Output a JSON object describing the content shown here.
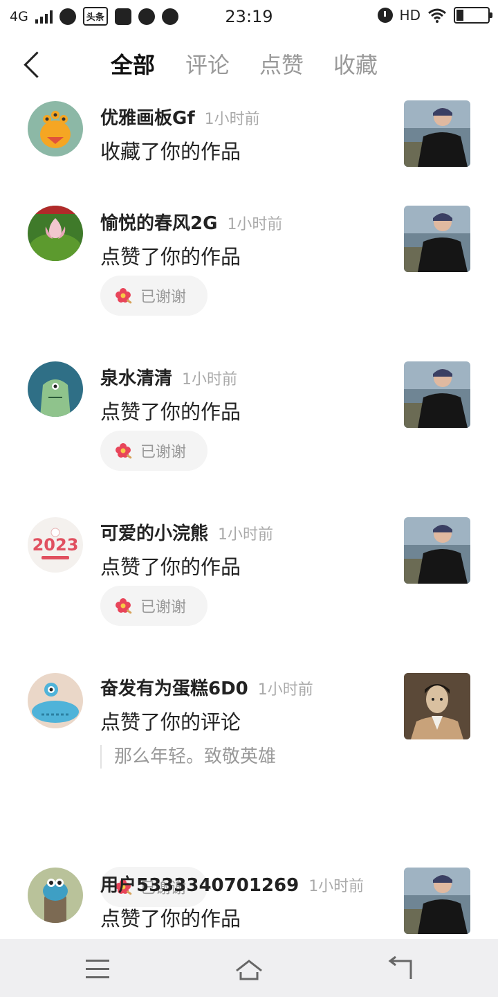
{
  "status_bar": {
    "network": "4G",
    "toutiao_label": "头条",
    "time": "23:19",
    "hd": "HD"
  },
  "tabs": [
    {
      "label": "全部",
      "active": true
    },
    {
      "label": "评论",
      "active": false
    },
    {
      "label": "点赞",
      "active": false
    },
    {
      "label": "收藏",
      "active": false
    }
  ],
  "notifications": [
    {
      "user": "优雅画板Gf",
      "time": "1小时前",
      "action": "收藏了你的作品",
      "thanked": null,
      "quote": null
    },
    {
      "user": "愉悦的春风2G",
      "time": "1小时前",
      "action": "点赞了你的作品",
      "thanked": "已谢谢",
      "quote": null
    },
    {
      "user": "泉水清清",
      "time": "1小时前",
      "action": "点赞了你的作品",
      "thanked": "已谢谢",
      "quote": null
    },
    {
      "user": "可爱的小浣熊",
      "time": "1小时前",
      "action": "点赞了你的作品",
      "thanked": "已谢谢",
      "quote": null
    },
    {
      "user": "奋发有为蛋糕6D0",
      "time": "1小时前",
      "action": "点赞了你的评论",
      "thanked": "已谢谢",
      "quote": "那么年轻。致敬英雄"
    },
    {
      "user": "用户5333340701269",
      "time": "1小时前",
      "action": "点赞了你的作品",
      "thanked": null,
      "quote": null
    }
  ],
  "avatar_art": {
    "year_text": "2023"
  },
  "colors": {
    "active_tab": "#111111",
    "inactive_tab": "#999999",
    "time_text": "#aaaaaa",
    "thanks_bg": "#f4f4f4",
    "navbar_bg": "#efeff1"
  },
  "icons": {
    "back": "chevron-left-icon",
    "thanks": "flower-icon",
    "nav_menu": "menu-icon",
    "nav_home": "home-icon",
    "nav_back": "back-arrow-icon"
  }
}
